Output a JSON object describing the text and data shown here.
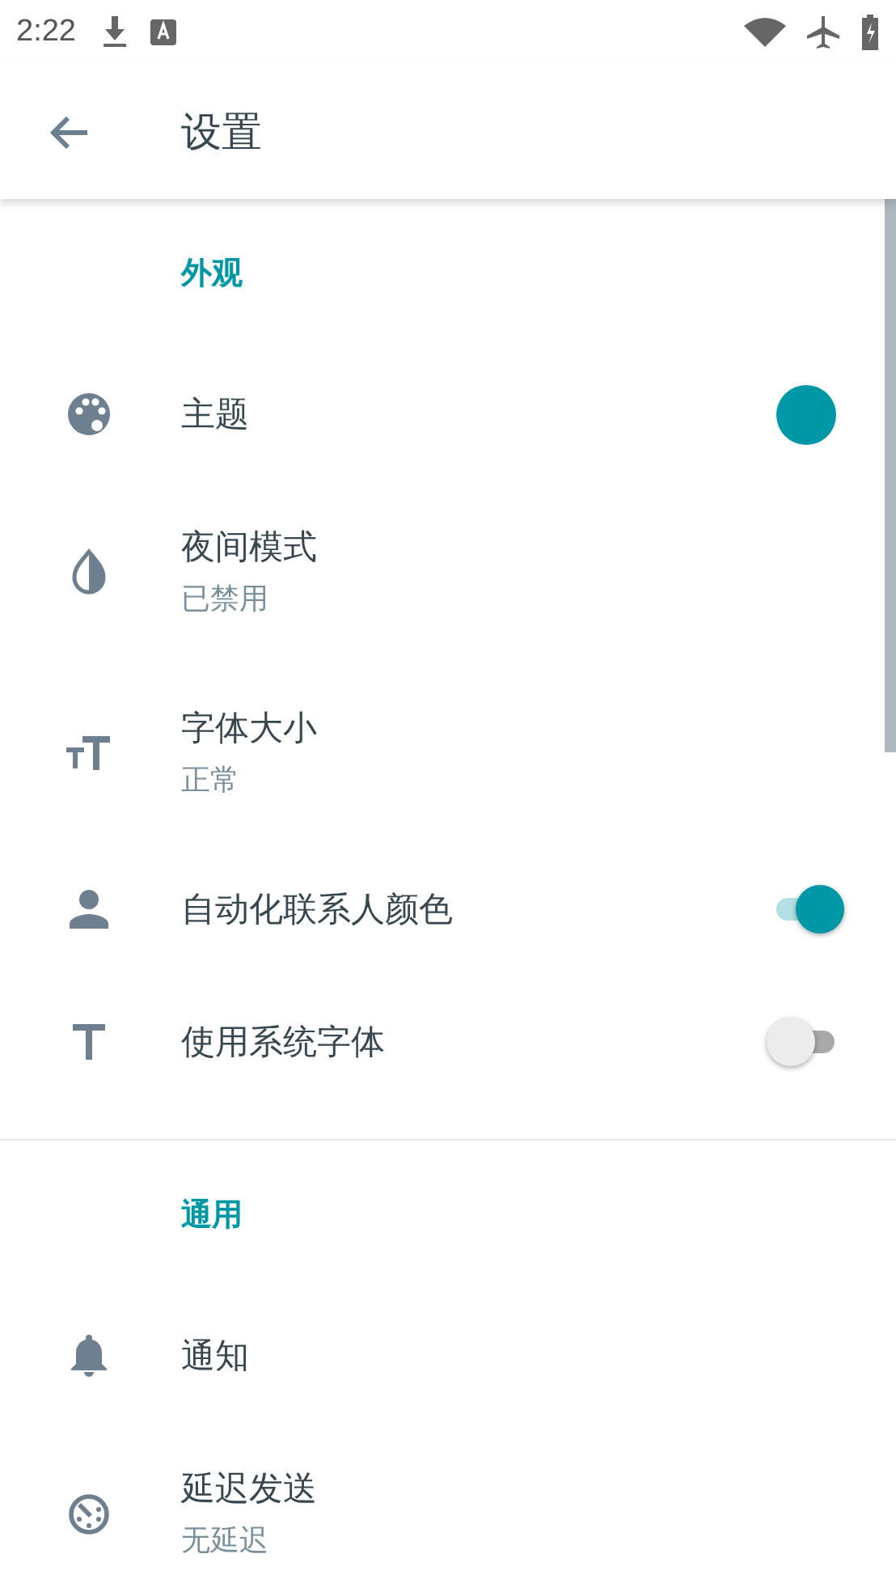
{
  "status_bar": {
    "time": "2:22"
  },
  "app_bar": {
    "title": "设置"
  },
  "sections": [
    {
      "header": "外观",
      "items": [
        {
          "kind": "color",
          "title": "主题",
          "color": "#0097a7"
        },
        {
          "kind": "plain",
          "title": "夜间模式",
          "summary": "已禁用"
        },
        {
          "kind": "plain",
          "title": "字体大小",
          "summary": "正常"
        },
        {
          "kind": "switch",
          "title": "自动化联系人颜色",
          "on": true
        },
        {
          "kind": "switch",
          "title": "使用系统字体",
          "on": false
        }
      ]
    },
    {
      "header": "通用",
      "items": [
        {
          "kind": "plain",
          "title": "通知"
        },
        {
          "kind": "plain",
          "title": "延迟发送",
          "summary": "无延迟"
        }
      ]
    }
  ]
}
